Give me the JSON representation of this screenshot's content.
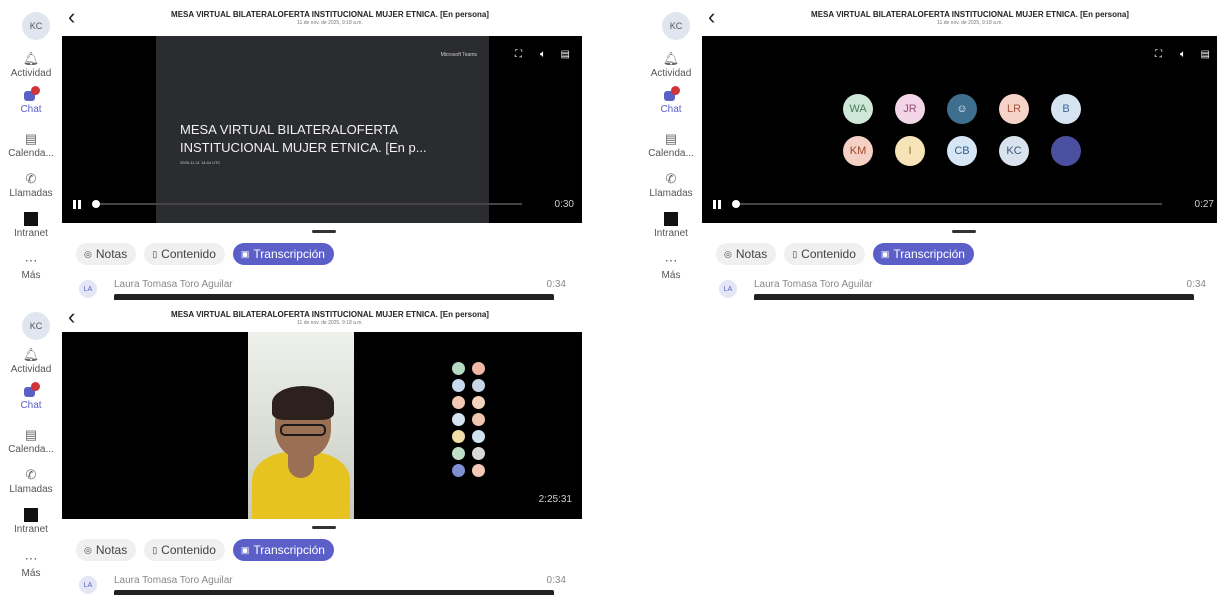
{
  "sidebar": {
    "avatar": "KC",
    "items": [
      {
        "label": "Actividad",
        "icon": "bell-icon"
      },
      {
        "label": "Chat",
        "icon": "chat-icon"
      },
      {
        "label": "Calenda...",
        "icon": "calendar-icon"
      },
      {
        "label": "Llamadas",
        "icon": "phone-icon"
      },
      {
        "label": "Intranet",
        "icon": "intranet-icon"
      },
      {
        "label": "Más",
        "icon": "more-icon"
      }
    ]
  },
  "meeting": {
    "title": "MESA VIRTUAL BILATERALOFERTA INSTITUCIONAL MUJER ETNICA. [En persona]",
    "subtitle": "11 de nov. de 2025, 9:18 a.m."
  },
  "slide": {
    "brand": "Microsoft Teams",
    "title": "MESA VIRTUAL BILATERALOFERTA INSTITUCIONAL MUJER ETNICA. [En p...",
    "date": "2025-11-11 14:44 UTC"
  },
  "tabs": [
    {
      "label": "Notas",
      "icon": "notes-icon"
    },
    {
      "label": "Contenido",
      "icon": "content-icon"
    },
    {
      "label": "Transcripción",
      "icon": "transcript-icon"
    }
  ],
  "transcript": {
    "initials": "LA",
    "speaker": "Laura Tomasa Toro Aguilar",
    "time": "0:34"
  },
  "player1": {
    "time": "0:30"
  },
  "player2": {
    "time": "0:27",
    "participants": [
      {
        "initials": "WA",
        "color": "#cfe7d6"
      },
      {
        "initials": "JR",
        "color": "#f2d5e6"
      },
      {
        "initials": "",
        "color": "#3f6f8f"
      },
      {
        "initials": "LR",
        "color": "#f6d3c9"
      },
      {
        "initials": "B",
        "color": "#d6e4f2"
      },
      {
        "initials": "KM",
        "color": "#f5d0c4"
      },
      {
        "initials": "I",
        "color": "#f7e3b8"
      },
      {
        "initials": "CB",
        "color": "#d6e6f5"
      },
      {
        "initials": "KC",
        "color": "#d9e3ee"
      },
      {
        "initials": "",
        "color": "#4b4fa0"
      }
    ]
  },
  "player3": {
    "time": "2:25:31"
  }
}
